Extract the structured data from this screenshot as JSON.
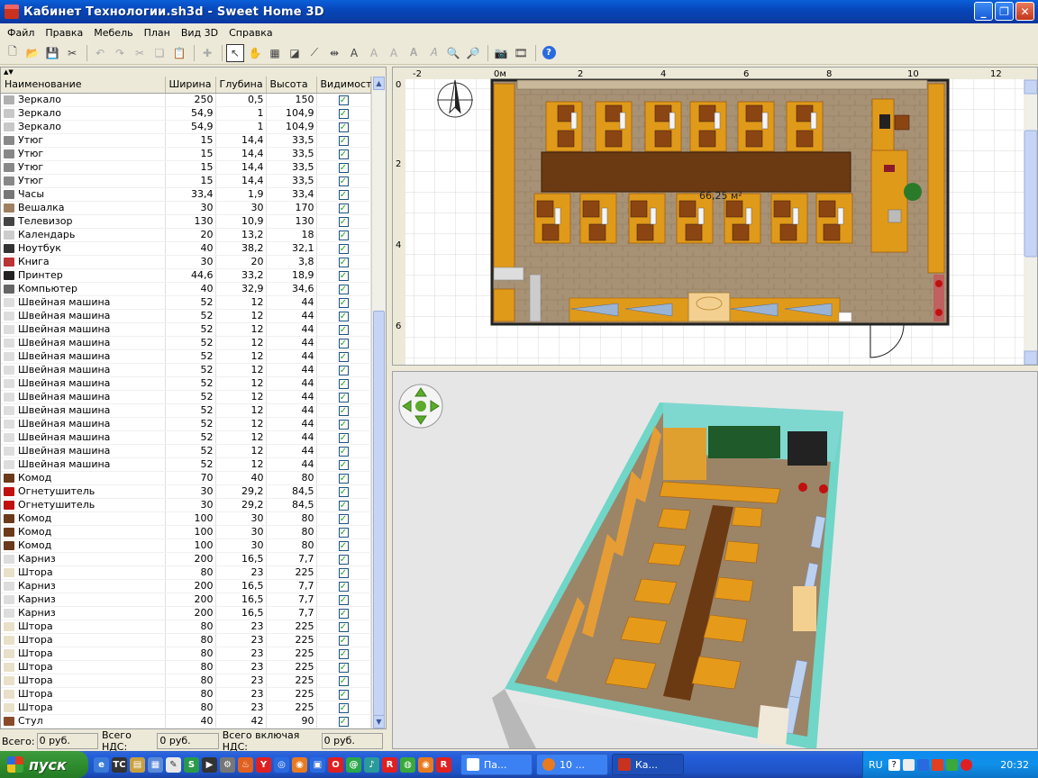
{
  "window": {
    "title": "Кабинет Технологии.sh3d - Sweet Home 3D"
  },
  "menu": [
    "Файл",
    "Правка",
    "Мебель",
    "План",
    "Вид 3D",
    "Справка"
  ],
  "furniture": {
    "columns": [
      "Наименование",
      "Ширина",
      "Глубина",
      "Высота",
      "Видимость"
    ],
    "rows": [
      [
        "Зеркало",
        "250",
        "0,5",
        "150"
      ],
      [
        "Зеркало",
        "54,9",
        "1",
        "104,9"
      ],
      [
        "Зеркало",
        "54,9",
        "1",
        "104,9"
      ],
      [
        "Утюг",
        "15",
        "14,4",
        "33,5"
      ],
      [
        "Утюг",
        "15",
        "14,4",
        "33,5"
      ],
      [
        "Утюг",
        "15",
        "14,4",
        "33,5"
      ],
      [
        "Утюг",
        "15",
        "14,4",
        "33,5"
      ],
      [
        "Часы",
        "33,4",
        "1,9",
        "33,4"
      ],
      [
        "Вешалка",
        "30",
        "30",
        "170"
      ],
      [
        "Телевизор",
        "130",
        "10,9",
        "130"
      ],
      [
        "Календарь",
        "20",
        "13,2",
        "18"
      ],
      [
        "Ноутбук",
        "40",
        "38,2",
        "32,1"
      ],
      [
        "Книга",
        "30",
        "20",
        "3,8"
      ],
      [
        "Принтер",
        "44,6",
        "33,2",
        "18,9"
      ],
      [
        "Компьютер",
        "40",
        "32,9",
        "34,6"
      ],
      [
        "Швейная машина",
        "52",
        "12",
        "44"
      ],
      [
        "Швейная машина",
        "52",
        "12",
        "44"
      ],
      [
        "Швейная машина",
        "52",
        "12",
        "44"
      ],
      [
        "Швейная машина",
        "52",
        "12",
        "44"
      ],
      [
        "Швейная машина",
        "52",
        "12",
        "44"
      ],
      [
        "Швейная машина",
        "52",
        "12",
        "44"
      ],
      [
        "Швейная машина",
        "52",
        "12",
        "44"
      ],
      [
        "Швейная машина",
        "52",
        "12",
        "44"
      ],
      [
        "Швейная машина",
        "52",
        "12",
        "44"
      ],
      [
        "Швейная машина",
        "52",
        "12",
        "44"
      ],
      [
        "Швейная машина",
        "52",
        "12",
        "44"
      ],
      [
        "Швейная машина",
        "52",
        "12",
        "44"
      ],
      [
        "Швейная машина",
        "52",
        "12",
        "44"
      ],
      [
        "Комод",
        "70",
        "40",
        "80"
      ],
      [
        "Огнетушитель",
        "30",
        "29,2",
        "84,5"
      ],
      [
        "Огнетушитель",
        "30",
        "29,2",
        "84,5"
      ],
      [
        "Комод",
        "100",
        "30",
        "80"
      ],
      [
        "Комод",
        "100",
        "30",
        "80"
      ],
      [
        "Комод",
        "100",
        "30",
        "80"
      ],
      [
        "Карниз",
        "200",
        "16,5",
        "7,7"
      ],
      [
        "Штора",
        "80",
        "23",
        "225"
      ],
      [
        "Карниз",
        "200",
        "16,5",
        "7,7"
      ],
      [
        "Карниз",
        "200",
        "16,5",
        "7,7"
      ],
      [
        "Карниз",
        "200",
        "16,5",
        "7,7"
      ],
      [
        "Штора",
        "80",
        "23",
        "225"
      ],
      [
        "Штора",
        "80",
        "23",
        "225"
      ],
      [
        "Штора",
        "80",
        "23",
        "225"
      ],
      [
        "Штора",
        "80",
        "23",
        "225"
      ],
      [
        "Штора",
        "80",
        "23",
        "225"
      ],
      [
        "Штора",
        "80",
        "23",
        "225"
      ],
      [
        "Штора",
        "80",
        "23",
        "225"
      ],
      [
        "Стул",
        "40",
        "42",
        "90"
      ]
    ],
    "icon_colors": [
      "#b0b0b0",
      "#c8c8c8",
      "#c8c8c8",
      "#888",
      "#888",
      "#888",
      "#888",
      "#777",
      "#a08060",
      "#444",
      "#ccc",
      "#333",
      "#b33",
      "#222",
      "#666",
      "#ddd",
      "#ddd",
      "#ddd",
      "#ddd",
      "#ddd",
      "#ddd",
      "#ddd",
      "#ddd",
      "#ddd",
      "#ddd",
      "#ddd",
      "#ddd",
      "#ddd",
      "#6b3a1a",
      "#c01010",
      "#c01010",
      "#6b3a1a",
      "#6b3a1a",
      "#6b3a1a",
      "#ddd",
      "#e8e0c8",
      "#ddd",
      "#ddd",
      "#ddd",
      "#e8e0c8",
      "#e8e0c8",
      "#e8e0c8",
      "#e8e0c8",
      "#e8e0c8",
      "#e8e0c8",
      "#e8e0c8",
      "#8a4a2a"
    ]
  },
  "plan": {
    "ruler_x": [
      "-2",
      "0м",
      "2",
      "4",
      "6",
      "8",
      "10",
      "12"
    ],
    "ruler_y": [
      "0",
      "2",
      "4",
      "6"
    ],
    "area_label": "66,25 м²"
  },
  "totals": {
    "total_label": "Всего:",
    "total_value": "0 руб.",
    "vat_label": "Всего НДС:",
    "vat_value": "0 руб.",
    "incl_label": "Всего включая НДС:",
    "incl_value": "0 руб."
  },
  "taskbar": {
    "start": "пуск",
    "tasks": [
      "Па...",
      "10 ...",
      "Ка..."
    ],
    "lang": "RU",
    "clock": "20:32"
  }
}
